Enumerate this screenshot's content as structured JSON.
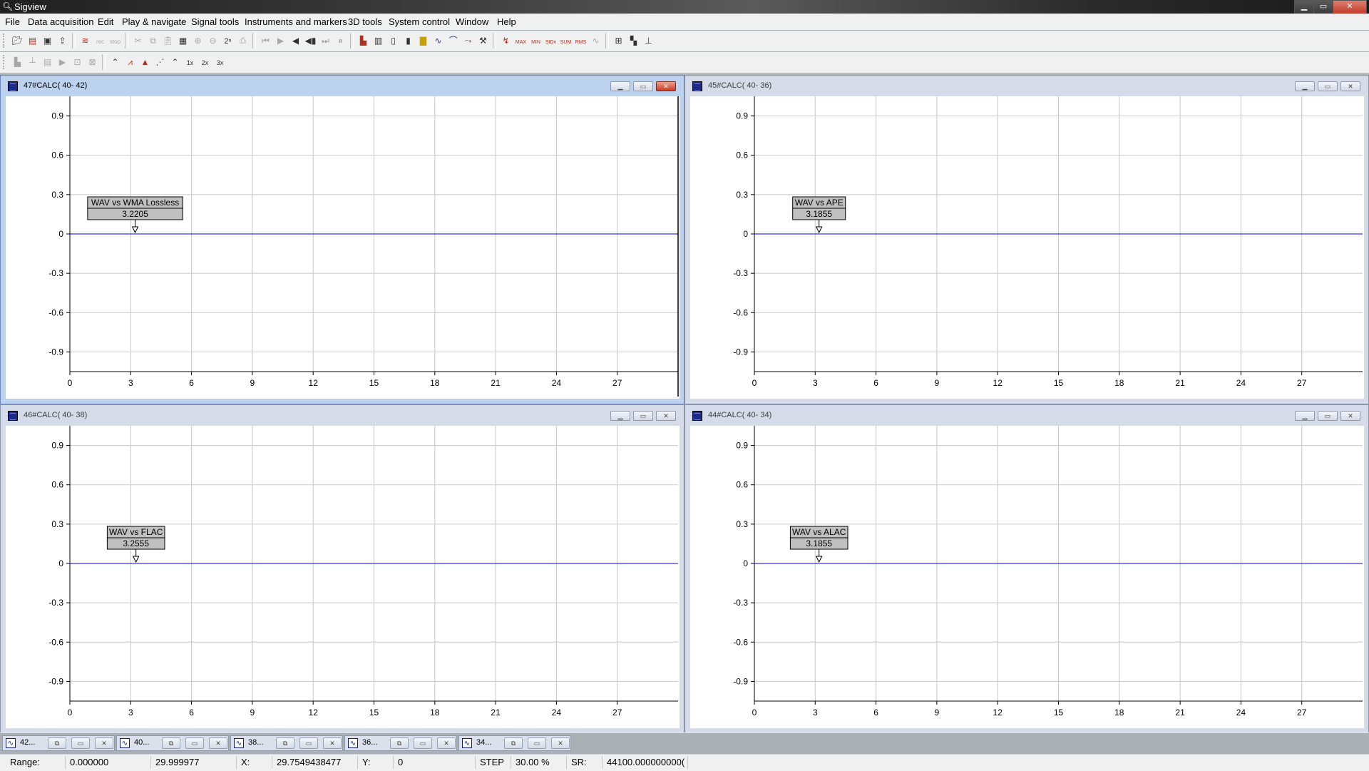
{
  "window": {
    "title": "Sigview",
    "controls": [
      "minimize",
      "maximize",
      "close"
    ]
  },
  "menu": [
    "File",
    "Data acquisition",
    "Edit",
    "Play & navigate",
    "Signal tools",
    "Instruments and markers",
    "3D tools",
    "System control",
    "Window",
    "Help"
  ],
  "toolbar1": {
    "groups": [
      [
        "open-folder-icon",
        "open-signal-icon",
        "save-icon",
        "export-icon"
      ],
      [
        "signal-generator-icon",
        "rec-icon",
        "stop-icon"
      ],
      [
        "cut-icon",
        "copy-icon",
        "paste-icon",
        "copy-image-icon",
        "zoom-in-icon",
        "zoom-out-icon",
        "power-of-two-icon",
        "print-icon"
      ],
      [
        "first-icon",
        "play-icon",
        "step-back-icon",
        "step-forward-icon",
        "last-icon",
        "pause-icon"
      ],
      [
        "spectrum-icon",
        "spectrogram-icon",
        "calculator-icon",
        "histogram-icon",
        "bars-icon",
        "wave-icon",
        "filter-icon",
        "transform-icon",
        "tools-icon"
      ],
      [
        "peak-marker-icon",
        "max-marker-icon",
        "min-marker-icon",
        "stdev-marker-icon",
        "sum-marker-icon",
        "rms-marker-icon",
        "cursor-marker-icon"
      ],
      [
        "tile-icon",
        "cascade-icon",
        "tree-icon"
      ]
    ],
    "labels": {
      "rec": "rec",
      "stop": "stop",
      "pow2": "2ⁿ",
      "max": "MAX",
      "min": "MIN",
      "stdev": "StDv",
      "sum": "SUM",
      "rms": "RMS"
    }
  },
  "toolbar2": {
    "groups": [
      [
        "bar-graph-icon",
        "stem-icon",
        "layout-icon",
        "line-style-icon",
        "grid-select-icon",
        "grid-zoom-icon"
      ],
      [
        "line-mode-icon",
        "peak-mode-icon",
        "fill-mode-icon",
        "dot-mode-icon",
        "spline-mode-icon",
        "scale-1x-icon",
        "scale-2x-icon",
        "scale-3x-icon"
      ]
    ],
    "labels": {
      "x1": "1x",
      "x2": "2x",
      "x3": "3x"
    }
  },
  "panels": [
    {
      "title": "47#CALC( 40- 42)",
      "active": true,
      "marker_label": "WAV vs WMA Lossless",
      "marker_value": "3.2205",
      "marker_x": 3.22
    },
    {
      "title": "45#CALC( 40- 36)",
      "active": false,
      "marker_label": "WAV vs APE",
      "marker_value": "3.1855",
      "marker_x": 3.19
    },
    {
      "title": "46#CALC( 40- 38)",
      "active": false,
      "marker_label": "WAV vs FLAC",
      "marker_value": "3.2555",
      "marker_x": 3.26
    },
    {
      "title": "44#CALC( 40- 34)",
      "active": false,
      "marker_label": "WAV vs ALAC",
      "marker_value": "3.1855",
      "marker_x": 3.19
    }
  ],
  "chart_data": [
    {
      "type": "line",
      "xlim": [
        0,
        30
      ],
      "ylim": [
        -1.05,
        1.05
      ],
      "x_ticks": [
        0,
        3,
        6,
        9,
        12,
        15,
        18,
        21,
        24,
        27
      ],
      "y_ticks": [
        0.9,
        0.6,
        0.3,
        0,
        -0.3,
        -0.6,
        -0.9
      ],
      "y_tick_labels": [
        "0.9",
        "0.6",
        "0.3",
        "0",
        "-0.3",
        "-0.6",
        "-0.9"
      ],
      "grid": true,
      "series": [
        {
          "color": "#0000ff",
          "x": [
            0,
            30
          ],
          "y": [
            0,
            0
          ]
        }
      ]
    },
    {
      "type": "line",
      "xlim": [
        0,
        30
      ],
      "ylim": [
        -1.05,
        1.05
      ],
      "x_ticks": [
        0,
        3,
        6,
        9,
        12,
        15,
        18,
        21,
        24,
        27
      ],
      "y_ticks": [
        0.9,
        0.6,
        0.3,
        0,
        -0.3,
        -0.6,
        -0.9
      ],
      "y_tick_labels": [
        "0.9",
        "0.6",
        "0.3",
        "0",
        "-0.3",
        "-0.6",
        "-0.9"
      ],
      "grid": true,
      "series": [
        {
          "color": "#0000ff",
          "x": [
            0,
            30
          ],
          "y": [
            0,
            0
          ]
        }
      ]
    },
    {
      "type": "line",
      "xlim": [
        0,
        30
      ],
      "ylim": [
        -1.05,
        1.05
      ],
      "x_ticks": [
        0,
        3,
        6,
        9,
        12,
        15,
        18,
        21,
        24,
        27
      ],
      "y_ticks": [
        0.9,
        0.6,
        0.3,
        0,
        -0.3,
        -0.6,
        -0.9
      ],
      "y_tick_labels": [
        "0.9",
        "0.6",
        "0.3",
        "0",
        "-0.3",
        "-0.6",
        "-0.9"
      ],
      "grid": true,
      "series": [
        {
          "color": "#0000ff",
          "x": [
            0,
            30
          ],
          "y": [
            0,
            0
          ]
        }
      ]
    },
    {
      "type": "line",
      "xlim": [
        0,
        30
      ],
      "ylim": [
        -1.05,
        1.05
      ],
      "x_ticks": [
        0,
        3,
        6,
        9,
        12,
        15,
        18,
        21,
        24,
        27
      ],
      "y_ticks": [
        0.9,
        0.6,
        0.3,
        0,
        -0.3,
        -0.6,
        -0.9
      ],
      "y_tick_labels": [
        "0.9",
        "0.6",
        "0.3",
        "0",
        "-0.3",
        "-0.6",
        "-0.9"
      ],
      "grid": true,
      "series": [
        {
          "color": "#0000ff",
          "x": [
            0,
            30
          ],
          "y": [
            0,
            0
          ]
        }
      ]
    }
  ],
  "taskbar": [
    {
      "label": "42..."
    },
    {
      "label": "40..."
    },
    {
      "label": "38..."
    },
    {
      "label": "36..."
    },
    {
      "label": "34..."
    }
  ],
  "statusbar": {
    "range_label": "Range:",
    "range_from": "0.000000",
    "range_to": "29.999977",
    "x_label": "X:",
    "x_value": "29.7549438477",
    "y_label": "Y:",
    "y_value": "0",
    "step_label": "STEP",
    "step_value": "30.00 %",
    "sr_label": "SR:",
    "sr_value": "44100.000000000("
  },
  "colors": {
    "active_panel": "#bcd2ee",
    "inactive_panel": "#d6dbe9",
    "signal": "#0000ff",
    "grid": "#c8c8c8",
    "marker_box": "#c0c0c0"
  }
}
